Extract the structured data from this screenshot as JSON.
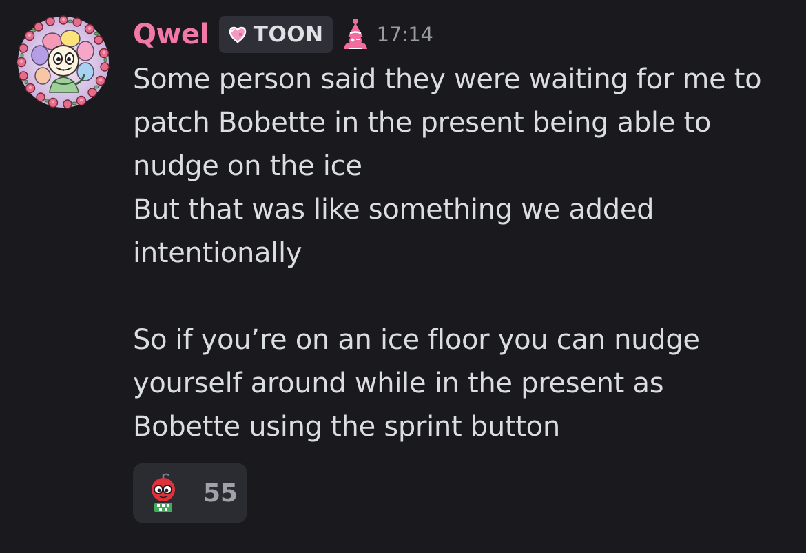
{
  "message": {
    "author": "Qwel",
    "tag": {
      "label": "TOON",
      "icon": "pixel-heart-icon"
    },
    "role_icon": "pink-clown-hat-icon",
    "timestamp": "17:14",
    "lines": [
      "Some person said they were waiting for me to",
      "patch Bobette in the present being able to",
      "nudge on the ice",
      "But that was like something we added",
      "intentionally",
      "",
      "So if you’re on an ice floor you can nudge",
      "yourself around while in the present as",
      "Bobette using the sprint button"
    ],
    "avatar_icon": "flower-character-avatar-with-rose-wreath",
    "reaction": {
      "emoji": "red-apple-character-emoji",
      "count": "55"
    }
  },
  "colors": {
    "background": "#1a1a1e",
    "username": "#f178a8",
    "text": "#dbdee1",
    "timestamp": "#9a9ca4",
    "tag_bg": "#2f3037",
    "reaction_bg": "#2b2c32"
  }
}
